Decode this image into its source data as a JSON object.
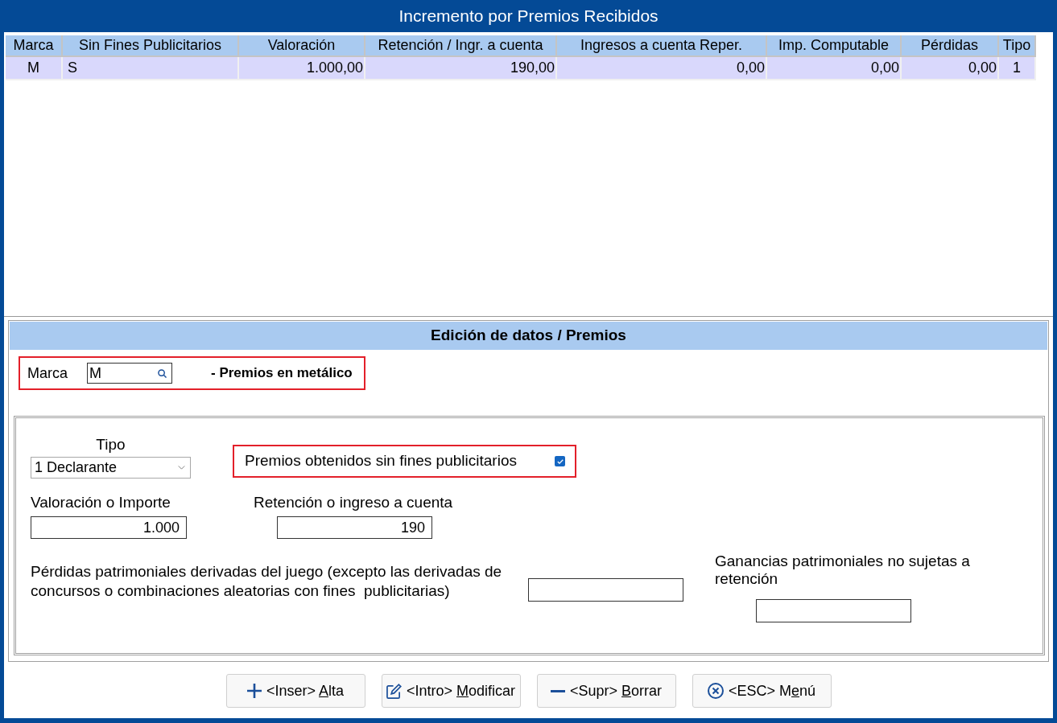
{
  "window": {
    "title": "Incremento por Premios Recibidos"
  },
  "table": {
    "columns": [
      {
        "label": "Marca",
        "kind": "code"
      },
      {
        "label": "Sin Fines Publicitarios",
        "kind": "text"
      },
      {
        "label": "Valoración",
        "kind": "amount"
      },
      {
        "label": "Retención / Ingr. a cuenta",
        "kind": "amount"
      },
      {
        "label": "Ingresos a cuenta Reper.",
        "kind": "amount"
      },
      {
        "label": "Imp. Computable",
        "kind": "amount"
      },
      {
        "label": "Pérdidas",
        "kind": "amount"
      },
      {
        "label": "Tipo",
        "kind": "code"
      }
    ],
    "rows": [
      {
        "selected": true,
        "cells": [
          "M",
          "S",
          "1.000,00",
          "190,00",
          "0,00",
          "0,00",
          "0,00",
          "1"
        ]
      }
    ]
  },
  "editor": {
    "title": "Edición de datos / Premios",
    "marca": {
      "label": "Marca",
      "value": "M",
      "description": "- Premios en metálico",
      "highlighted": true
    },
    "tipo": {
      "label": "Tipo",
      "value": "1 Declarante"
    },
    "sin_fines": {
      "label": "Premios obtenidos sin fines publicitarios",
      "checked": true,
      "highlighted": true
    },
    "valoracion": {
      "label": "Valoración o Importe",
      "value": "1.000"
    },
    "retencion": {
      "label": "Retención o ingreso a cuenta",
      "value": "190"
    },
    "perdidas": {
      "label": "Pérdidas patrimoniales derivadas del juego (excepto las derivadas de concursos o combinaciones aleatorias con fines  publicitarias)"
    },
    "ganancias": {
      "label": "Ganancias patrimoniales no sujetas a retención"
    }
  },
  "buttons": [
    {
      "kind": "add",
      "key": "<Inser>",
      "underlined": "A",
      "after": "lta"
    },
    {
      "kind": "edit",
      "key": "<Intro>",
      "underlined": "M",
      "after": "odificar"
    },
    {
      "kind": "remove",
      "key": "<Supr>",
      "underlined": "B",
      "after": "orrar"
    },
    {
      "kind": "exit",
      "key": "<ESC>",
      "before": "M",
      "underlined": "e",
      "after": "nú"
    }
  ]
}
